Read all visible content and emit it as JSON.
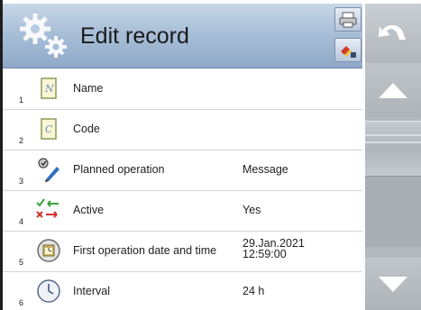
{
  "header": {
    "title": "Edit record",
    "icons": [
      "settings-gears-icon",
      "print-icon",
      "export-icon"
    ]
  },
  "rows": [
    {
      "index": "1",
      "icon": "name-document-icon",
      "label": "Name",
      "value": ""
    },
    {
      "index": "2",
      "icon": "code-document-icon",
      "label": "Code",
      "value": ""
    },
    {
      "index": "3",
      "icon": "planned-operation-icon",
      "label": "Planned operation",
      "value": "Message"
    },
    {
      "index": "4",
      "icon": "active-toggle-icon",
      "label": "Active",
      "value": "Yes"
    },
    {
      "index": "5",
      "icon": "calendar-clock-icon",
      "label": "First operation date and time",
      "value_line1": "29.Jan.2021",
      "value_line2": "12:59:00"
    },
    {
      "index": "6",
      "icon": "clock-icon",
      "label": "Interval",
      "value": "24 h"
    }
  ],
  "sidebar": {
    "icons": [
      "undo-arrow-icon",
      "scroll-up-icon",
      "scroll-down-icon"
    ],
    "colors": {
      "button": "#b4b9be",
      "glyph": "#ffffff"
    }
  },
  "colors": {
    "header_top": "#c9d7e8",
    "header_bottom": "#8fa9c8",
    "divider": "#d4d4d4"
  }
}
